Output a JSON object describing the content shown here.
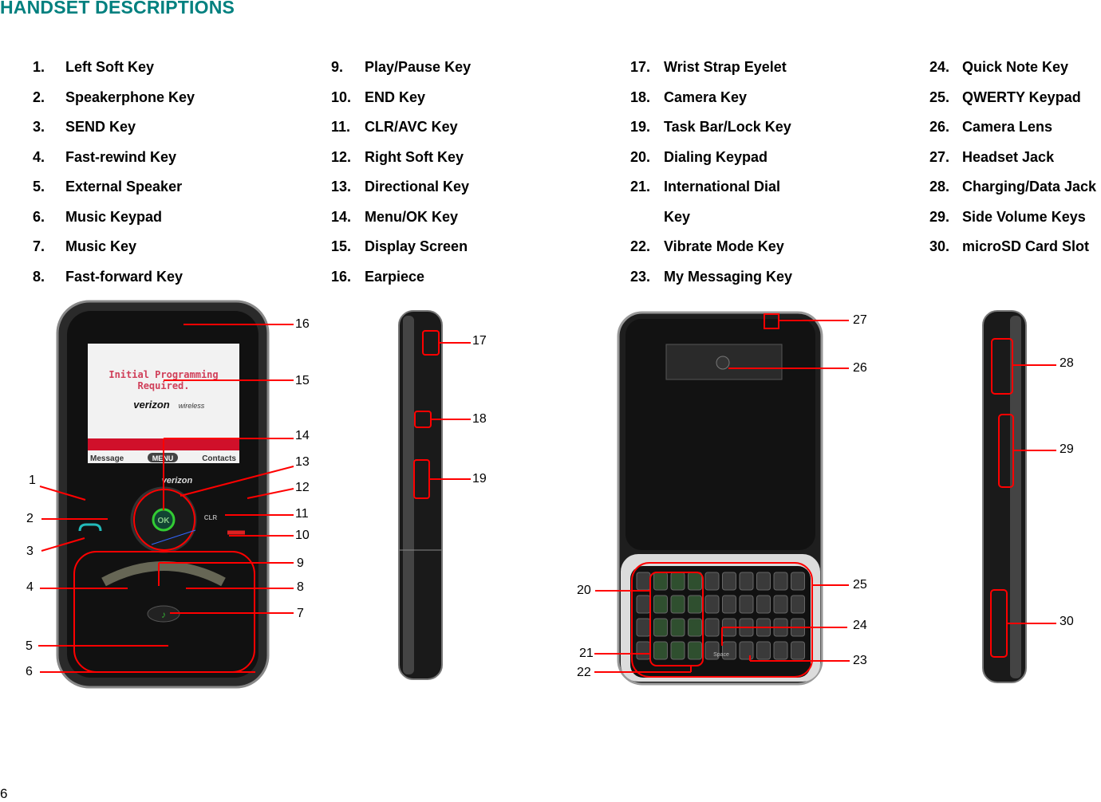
{
  "heading": "HANDSET DESCRIPTIONS",
  "items": [
    {
      "n": "1.",
      "label": "Left Soft Key"
    },
    {
      "n": "2.",
      "label": "Speakerphone Key"
    },
    {
      "n": "3.",
      "label": "SEND Key"
    },
    {
      "n": "4.",
      "label": "Fast-rewind Key"
    },
    {
      "n": "5.",
      "label": "External Speaker"
    },
    {
      "n": "6.",
      "label": "Music Keypad"
    },
    {
      "n": "7.",
      "label": "Music Key"
    },
    {
      "n": "8.",
      "label": "Fast-forward Key"
    },
    {
      "n": "9.",
      "label": "Play/Pause Key"
    },
    {
      "n": "10.",
      "label": "END Key"
    },
    {
      "n": "11.",
      "label": "CLR/AVC Key"
    },
    {
      "n": "12.",
      "label": " Right Soft Key"
    },
    {
      "n": "13.",
      "label": "Directional Key"
    },
    {
      "n": "14.",
      "label": "Menu/OK Key"
    },
    {
      "n": "15.",
      "label": "Display Screen"
    },
    {
      "n": "16.",
      "label": "Earpiece"
    },
    {
      "n": "17.",
      "label": "Wrist Strap Eyelet"
    },
    {
      "n": "18.",
      "label": "Camera Key"
    },
    {
      "n": "19.",
      "label": "Task Bar/Lock Key"
    },
    {
      "n": "20.",
      "label": "Dialing Keypad"
    },
    {
      "n": "21.",
      "label": "International Dial"
    },
    {
      "n": "",
      "label": "Key"
    },
    {
      "n": "22.",
      "label": "Vibrate Mode Key"
    },
    {
      "n": "23.",
      "label": "My Messaging Key"
    },
    {
      "n": "24.",
      "label": "Quick Note Key"
    },
    {
      "n": "25.",
      "label": "QWERTY Keypad"
    },
    {
      "n": "26.",
      "label": "Camera Lens"
    },
    {
      "n": "27.",
      "label": "Headset Jack"
    },
    {
      "n": "28.",
      "label": "Charging/Data Jack"
    },
    {
      "n": "29.",
      "label": "Side Volume Keys"
    },
    {
      "n": "30.",
      "label": "microSD Card Slot"
    }
  ],
  "callouts": [
    "1",
    "2",
    "3",
    "4",
    "5",
    "6",
    "7",
    "8",
    "9",
    "10",
    "11",
    "12",
    "13",
    "14",
    "15",
    "16",
    "17",
    "18",
    "19",
    "20",
    "21",
    "22",
    "23",
    "24",
    "25",
    "26",
    "27",
    "28",
    "29",
    "30"
  ],
  "phone_screen": {
    "line1": "Initial Programming",
    "line2": "Required.",
    "brand": "verizon",
    "brand_suffix": "wireless",
    "left_softkey": "Message",
    "center_softkey": "MENU",
    "right_softkey": "Contacts",
    "ok_key": "OK",
    "clr_key": "CLR",
    "space_key": "Space"
  },
  "page_number": "6",
  "colors": {
    "heading": "#00807f",
    "callout_line": "#ff0000"
  }
}
